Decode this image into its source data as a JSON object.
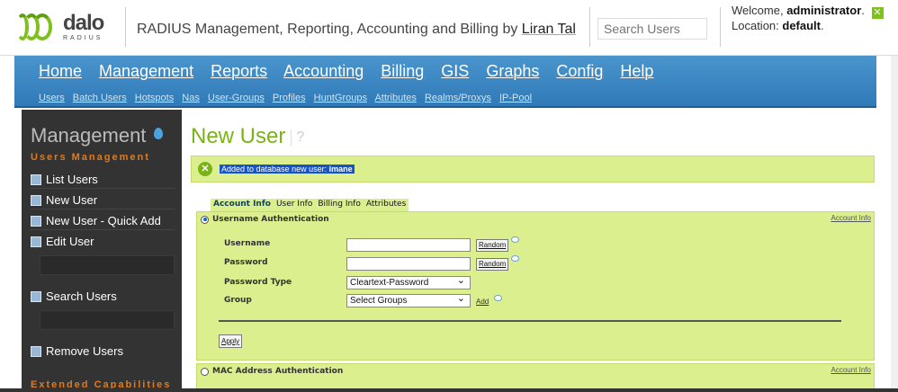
{
  "header": {
    "logo_name": "dalo",
    "logo_sub": "RADIUS",
    "tagline": "RADIUS Management, Reporting, Accounting and Billing by",
    "author": "Liran Tal",
    "search_placeholder": "Search Users",
    "welcome_label": "Welcome,",
    "user": "administrator",
    "location_label": "Location:",
    "location": "default"
  },
  "nav": {
    "main": [
      "Home",
      "Management",
      "Reports",
      "Accounting",
      "Billing",
      "GIS",
      "Graphs",
      "Config",
      "Help"
    ],
    "sub": [
      "Users",
      "Batch Users",
      "Hotspots",
      "Nas",
      "User-Groups",
      "Profiles",
      "HuntGroups",
      "Attributes",
      "Realms/Proxys",
      "IP-Pool"
    ]
  },
  "sidebar": {
    "title": "Management",
    "section1": "Users Management",
    "items": [
      "List Users",
      "New User",
      "New User - Quick Add",
      "Edit User",
      "Search Users",
      "Remove Users"
    ],
    "section2": "Extended Capabilities"
  },
  "main": {
    "title": "New User",
    "message": "Added to database new user:",
    "message_user": "imane",
    "tabs": [
      "Account Info",
      "User Info",
      "Billing Info",
      "Attributes"
    ],
    "panel1": {
      "heading": "Username Authentication",
      "link": "Account Info",
      "fields": {
        "username_label": "Username",
        "password_label": "Password",
        "ptype_label": "Password Type",
        "ptype_value": "Cleartext-Password",
        "group_label": "Group",
        "group_value": "Select Groups"
      },
      "random_label": "Random",
      "add_label": "Add",
      "apply_label": "Apply"
    },
    "panel2": {
      "heading": "MAC Address Authentication",
      "link": "Account Info"
    }
  },
  "colors": {
    "accent_green": "#7ab317",
    "nav_blue": "#3a86c2",
    "panel_green": "#dbef8f",
    "sidebar_bg": "#333333",
    "section_orange": "#e07a1a"
  }
}
